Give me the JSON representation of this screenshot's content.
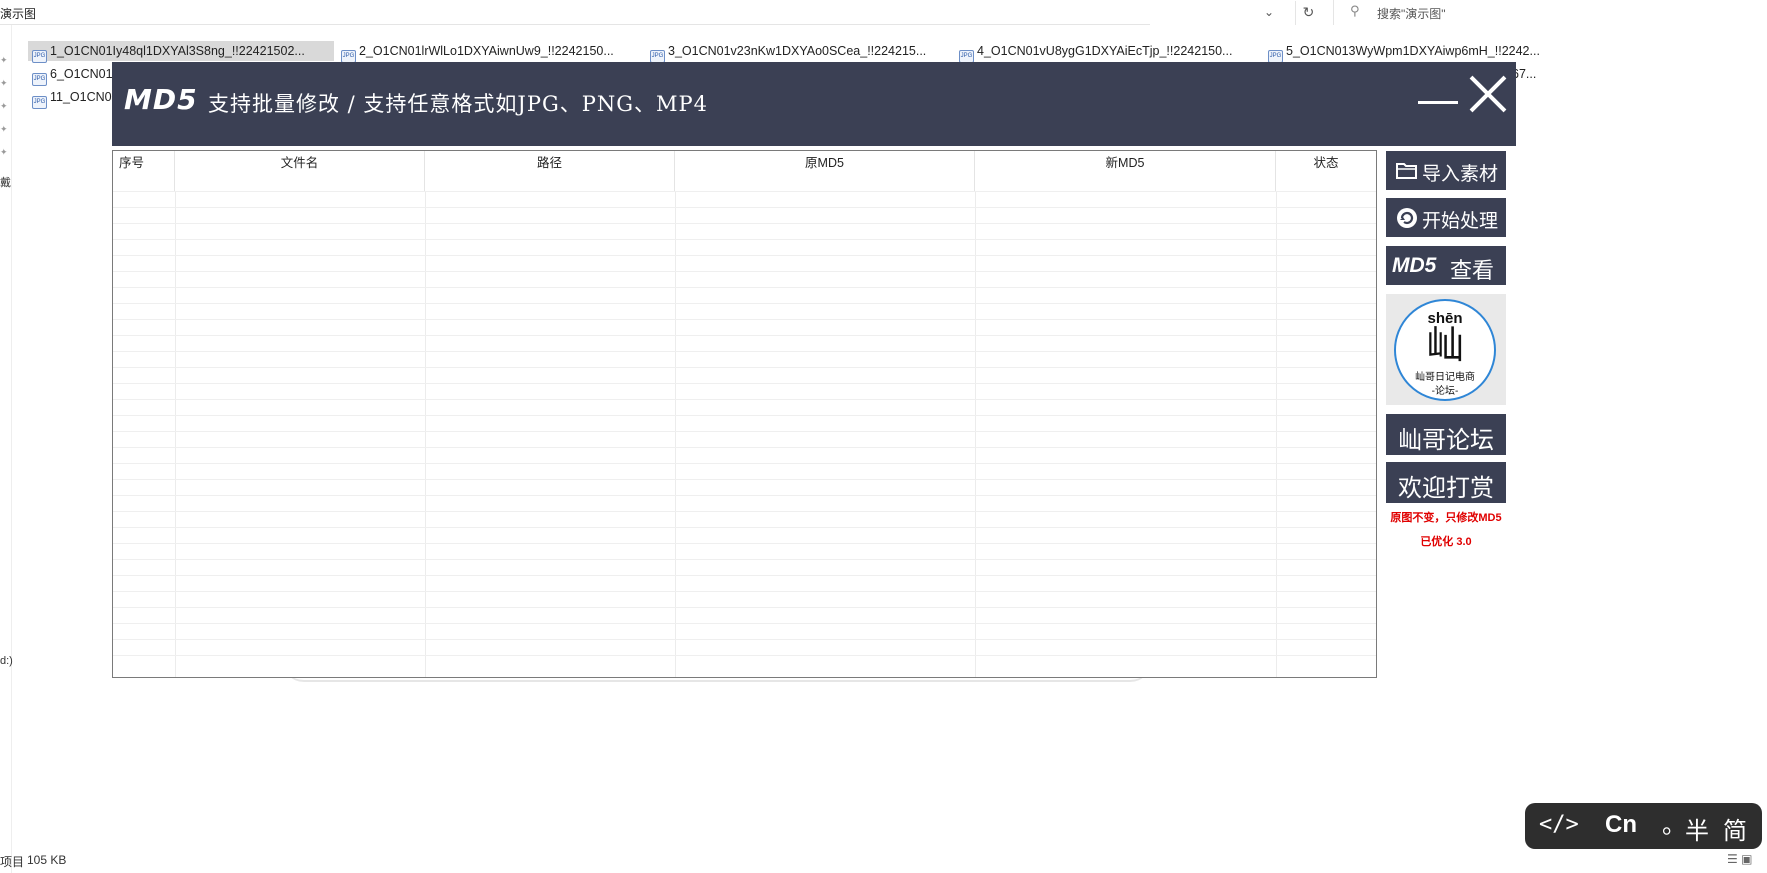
{
  "explorer": {
    "address": "演示图",
    "search_placeholder": "搜索\"演示图\"",
    "nav_fragments": [
      "戴",
      "d:)"
    ],
    "files": [
      {
        "label": "1_O1CN01Iy48ql1DXYAl3S8ng_!!22421502...",
        "icon": "JPG",
        "selected": true
      },
      {
        "label": "2_O1CN01lrWlLo1DXYAiwnUw9_!!2242150...",
        "icon": "JPG"
      },
      {
        "label": "3_O1CN01v23nKw1DXYAo0SCea_!!224215...",
        "icon": "JPG"
      },
      {
        "label": "4_O1CN01vU8ygG1DXYAiEcTjp_!!2242150...",
        "icon": "JPG"
      },
      {
        "label": "5_O1CN013WyWpm1DXYAiwp6mH_!!2242...",
        "icon": "JPG"
      },
      {
        "label": "6_O1CN01",
        "icon": "JPG"
      },
      {
        "label": "11_O1CN0",
        "icon": "JPG"
      },
      {
        "label": "67...",
        "icon": ""
      }
    ],
    "status_items": "项目",
    "status_size": "105 KB"
  },
  "app": {
    "logo": "MD5",
    "title": "支持批量修改 / 支持任意格式如JPG、PNG、MP4",
    "colors": {
      "header_bg": "#3b4054",
      "button_bg": "#3b4054",
      "note_red": "#e00000",
      "logo_ring": "#2f86d6"
    },
    "table": {
      "columns": [
        "序号",
        "文件名",
        "路径",
        "原MD5",
        "新MD5",
        "状态"
      ],
      "rows": []
    },
    "buttons": {
      "import": "导入素材",
      "start": "开始处理",
      "md5_logo": "MD5",
      "md5_view": "查看",
      "forum": "屾哥论坛",
      "reward": "欢迎打赏"
    },
    "forum_logo": {
      "pinyin": "shēn",
      "char": "屾",
      "line1": "屾哥日记电商",
      "line2": "-论坛-"
    },
    "notes": {
      "unchanged": "原图不变，只修改MD5",
      "version": "已优化 3.0"
    }
  },
  "ime": {
    "code": "</>",
    "lang": "Cn",
    "punct": "。",
    "width": "半",
    "charset": "简"
  }
}
